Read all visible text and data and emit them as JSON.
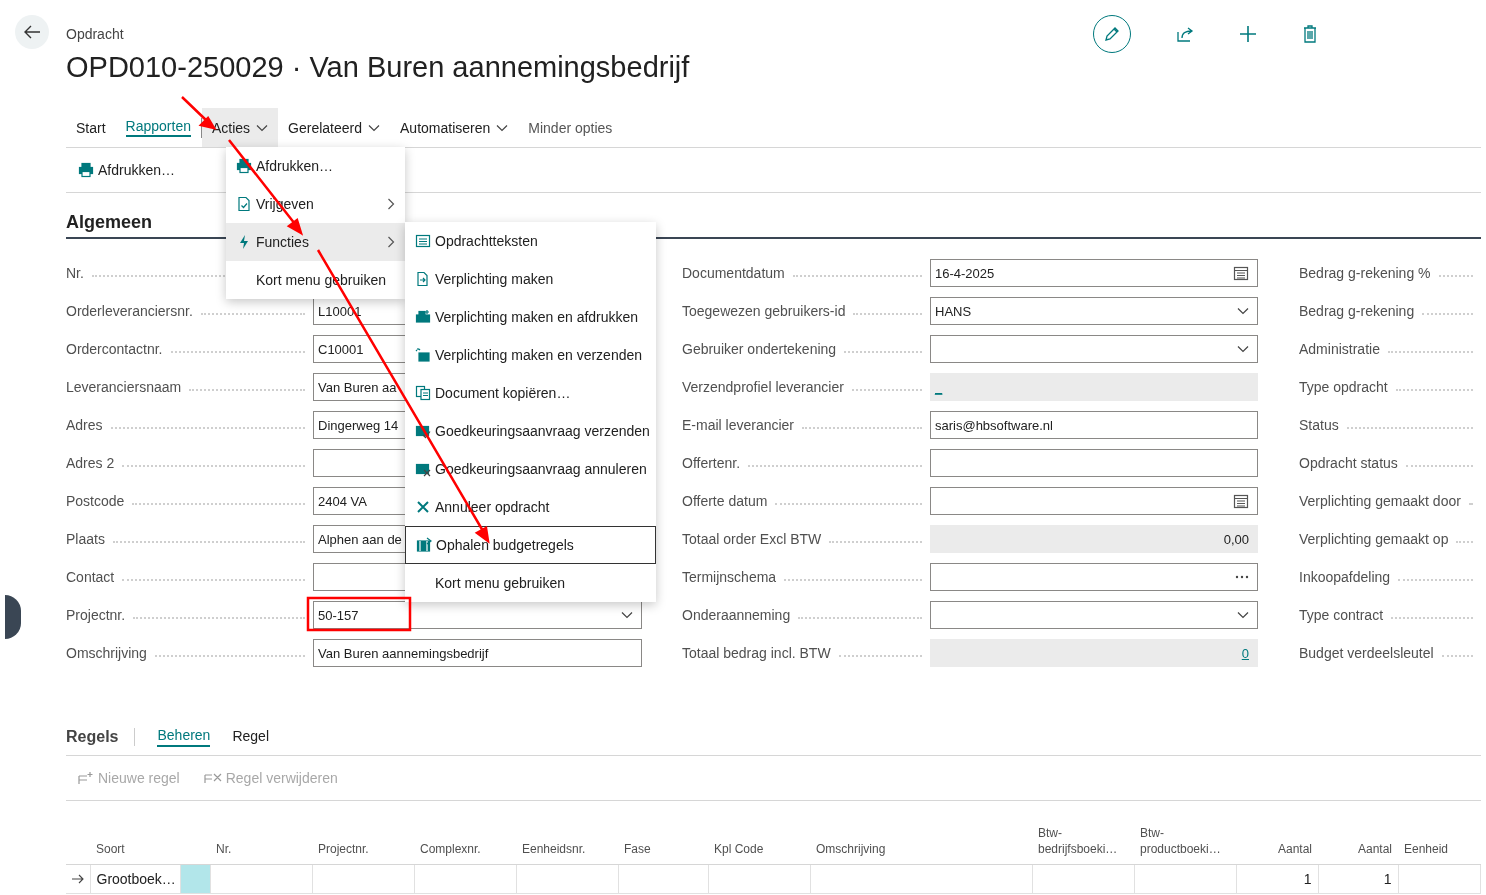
{
  "header": {
    "breadcrumb": "Opdracht",
    "title": "OPD010-250029 · Van Buren aannemingsbedrijf"
  },
  "action_tabs": [
    {
      "label": "Start",
      "selected": false,
      "expanded": false,
      "kind": "plain"
    },
    {
      "label": "Rapporten",
      "selected": true,
      "expanded": false,
      "kind": "plain"
    },
    {
      "label": "Acties",
      "selected": false,
      "expanded": true,
      "kind": "dropdown"
    },
    {
      "label": "Gerelateerd",
      "selected": false,
      "expanded": false,
      "kind": "dropdown"
    },
    {
      "label": "Automatiseren",
      "selected": false,
      "expanded": false,
      "kind": "dropdown"
    },
    {
      "label": "Minder opties",
      "selected": false,
      "expanded": false,
      "kind": "toggle"
    }
  ],
  "toolbar": [
    {
      "label": "Afdrukken…"
    }
  ],
  "actions_menu": [
    {
      "label": "Afdrukken…",
      "submenu": false,
      "selected": false
    },
    {
      "label": "Vrijgeven",
      "submenu": true,
      "selected": false
    },
    {
      "label": "Functies",
      "submenu": true,
      "selected": true
    },
    {
      "label": "Kort menu gebruiken",
      "submenu": false,
      "selected": false
    }
  ],
  "functions_menu": [
    {
      "label": "Opdrachtteksten",
      "selected": false
    },
    {
      "label": "Verplichting maken",
      "selected": false
    },
    {
      "label": "Verplichting maken en afdrukken",
      "selected": false
    },
    {
      "label": "Verplichting maken en verzenden",
      "selected": false
    },
    {
      "label": "Document kopiëren…",
      "selected": false
    },
    {
      "label": "Goedkeuringsaanvraag verzenden",
      "selected": false
    },
    {
      "label": "Goedkeuringsaanvraag annuleren",
      "selected": false
    },
    {
      "label": "Annuleer opdracht",
      "selected": false
    },
    {
      "label": "Ophalen budgetregels",
      "selected": true
    },
    {
      "label": "Kort menu gebruiken",
      "selected": false
    }
  ],
  "section": {
    "title": "Algemeen"
  },
  "fields_left": [
    {
      "label": "Nr.",
      "kind": "text"
    },
    {
      "label": "Orderleveranciersnr.",
      "kind": "text",
      "value": "L10001"
    },
    {
      "label": "Ordercontactnr.",
      "kind": "text",
      "value": "C10001"
    },
    {
      "label": "Leveranciersnaam",
      "kind": "text",
      "value": "Van Buren aa"
    },
    {
      "label": "Adres",
      "kind": "text",
      "value": "Dingerweg 14"
    },
    {
      "label": "Adres 2",
      "kind": "text"
    },
    {
      "label": "Postcode",
      "kind": "text",
      "value": "2404 VA"
    },
    {
      "label": "Plaats",
      "kind": "text",
      "value": "Alphen aan de"
    },
    {
      "label": "Contact",
      "kind": "text"
    },
    {
      "label": "Projectnr.",
      "kind": "dropdown",
      "value": "50-157"
    },
    {
      "label": "Omschrijving",
      "kind": "text",
      "value": "Van Buren aannemingsbedrijf"
    }
  ],
  "fields_middle": [
    {
      "label": "Documentdatum",
      "kind": "date",
      "value": "16-4-2025"
    },
    {
      "label": "Toegewezen gebruikers-id",
      "kind": "dropdown",
      "value": "HANS"
    },
    {
      "label": "Gebruiker ondertekening",
      "kind": "dropdown"
    },
    {
      "label": "Verzendprofiel leverancier",
      "kind": "readonly_link",
      "value": "_"
    },
    {
      "label": "E-mail leverancier",
      "kind": "text",
      "value": "saris@hbsoftware.nl"
    },
    {
      "label": "Offertenr.",
      "kind": "text"
    },
    {
      "label": "Offerte datum",
      "kind": "date"
    },
    {
      "label": "Totaal order Excl BTW",
      "kind": "amount",
      "value": "0,00"
    },
    {
      "label": "Termijnschema",
      "kind": "lookup"
    },
    {
      "label": "Onderaanneming",
      "kind": "dropdown"
    },
    {
      "label": "Totaal bedrag incl. BTW",
      "kind": "amount_link",
      "value": "0"
    }
  ],
  "fields_right": [
    {
      "label": "Bedrag g-rekening %"
    },
    {
      "label": "Bedrag g-rekening"
    },
    {
      "label": "Administratie"
    },
    {
      "label": "Type opdracht"
    },
    {
      "label": "Status"
    },
    {
      "label": "Opdracht status"
    },
    {
      "label": "Verplichting gemaakt door"
    },
    {
      "label": "Verplichting gemaakt op"
    },
    {
      "label": "Inkoopafdeling"
    },
    {
      "label": "Type contract"
    },
    {
      "label": "Budget verdeelsleutel"
    }
  ],
  "lines": {
    "title": "Regels",
    "tabs": [
      {
        "label": "Beheren",
        "selected": true
      },
      {
        "label": "Regel",
        "selected": false
      }
    ],
    "actions": [
      {
        "label": "Nieuwe regel",
        "disabled": true
      },
      {
        "label": "Regel verwijderen",
        "disabled": true
      }
    ],
    "columns": [
      "Soort",
      "Nr.",
      "Projectnr.",
      "Complexnr.",
      "Eenheidsnr.",
      "Fase",
      "Kpl Code",
      "Omschrijving",
      "Btw-bedrijfsboeki…",
      "Btw-productboeki…",
      "Aantal",
      "Aantal",
      "Eenheid"
    ],
    "rows": [
      {
        "selected": true,
        "cells": [
          "Grootboek…",
          "",
          "",
          "",
          "",
          "",
          "",
          "",
          "",
          "",
          "1",
          "1",
          ""
        ]
      }
    ]
  }
}
